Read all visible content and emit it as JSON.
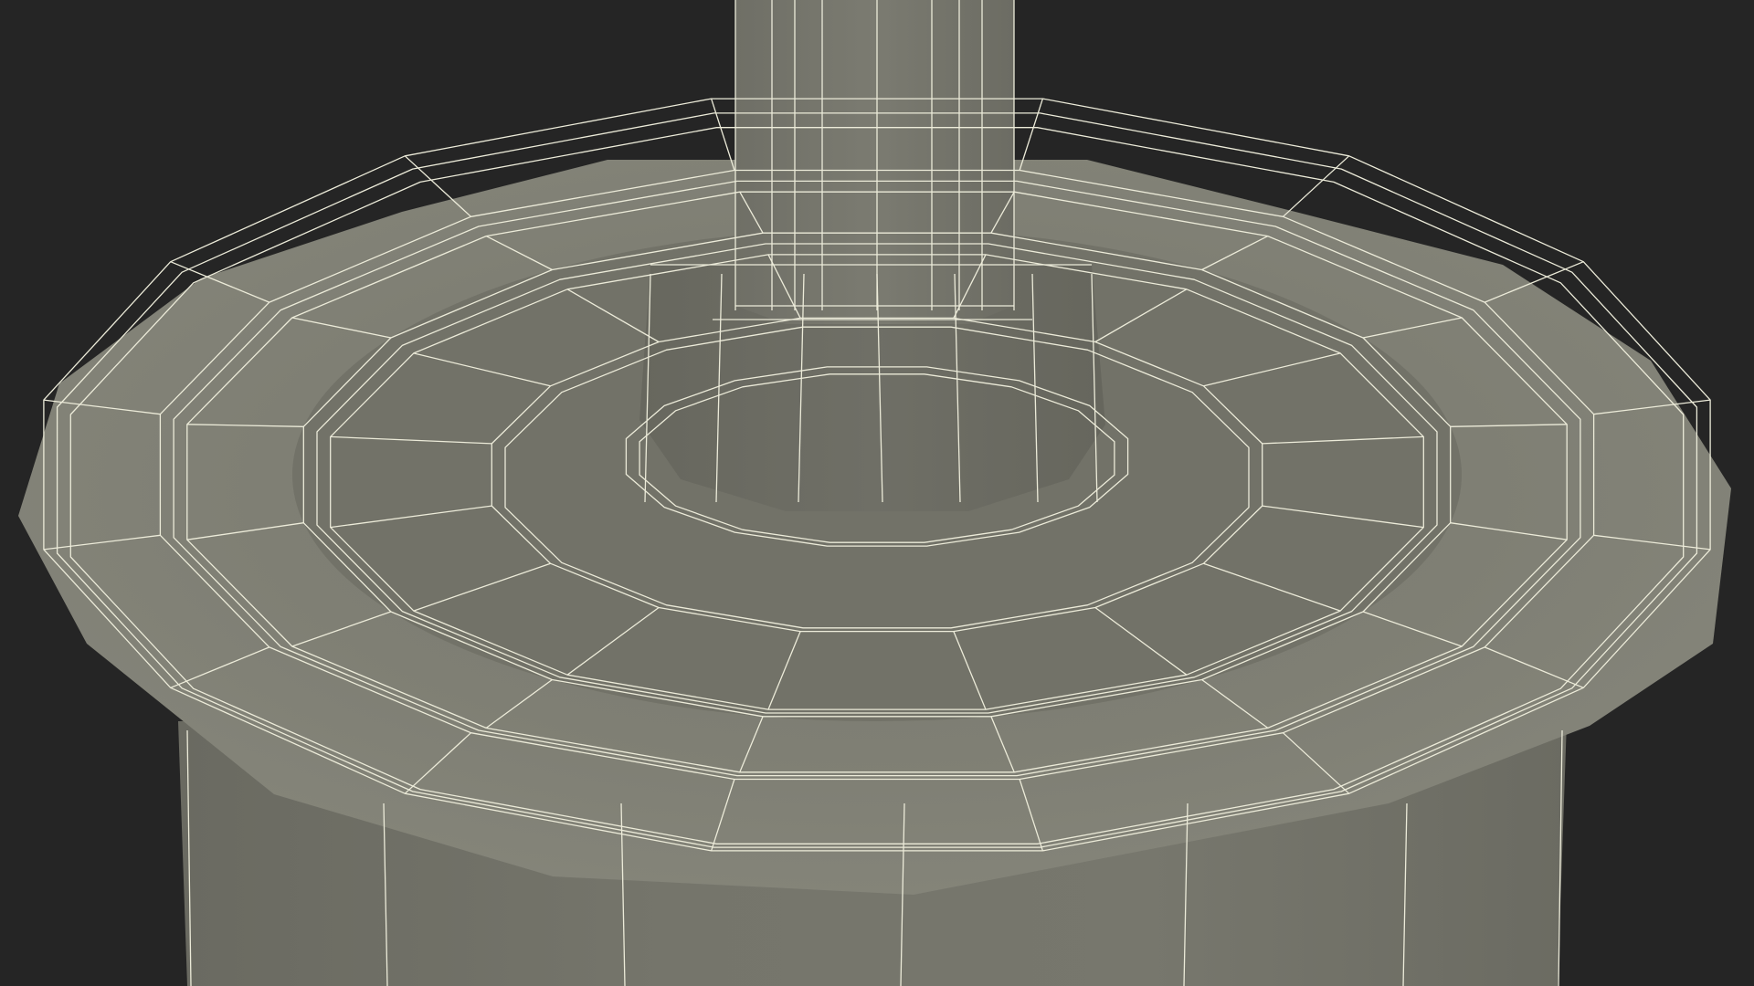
{
  "colors": {
    "background": "#252525",
    "surface_light": "#85857a",
    "surface_mid": "#76766b",
    "surface_dark": "#5f5f56",
    "wireframe": "#ecebd9"
  },
  "icons": {
    "render": "wireframe-mesh-icon"
  }
}
